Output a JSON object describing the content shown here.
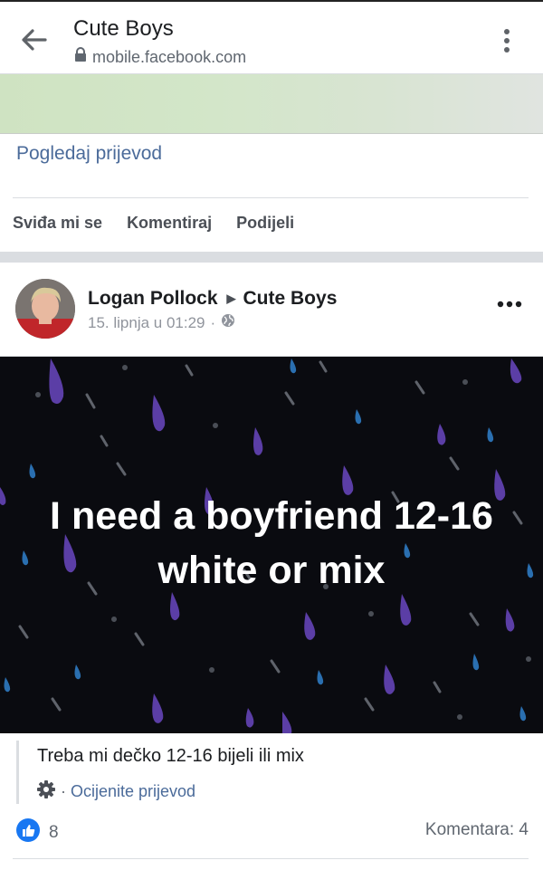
{
  "browser": {
    "title": "Cute Boys",
    "url": "mobile.facebook.com"
  },
  "prev_post": {
    "translate_link": "Pogledaj prijevod",
    "actions": [
      "Sviđa mi se",
      "Komentiraj",
      "Podijeli"
    ]
  },
  "post": {
    "author": "Logan Pollock",
    "group": "Cute Boys",
    "timestamp": "15. lipnja u 01:29",
    "image_text": "I need a boyfriend 12-16 white or mix",
    "translation": "Treba mi dečko 12-16 bijeli ili mix",
    "rate_translation": "Ocijenite prijevod",
    "likes": "8",
    "comments": "Komentara: 4"
  },
  "colors": {
    "link": "#4b6b9a",
    "like_blue": "#1877f2",
    "image_bg": "#0a0b10",
    "drop_purple": "#5b3ea6",
    "drop_blue": "#2a6fb0"
  }
}
